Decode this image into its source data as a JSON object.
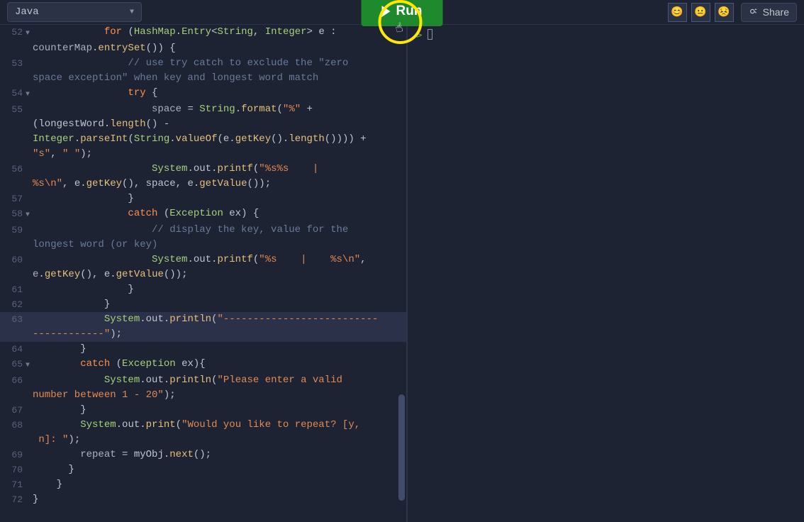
{
  "toolbar": {
    "language": "Java",
    "run_label": "Run",
    "share_label": "Share",
    "avatars": [
      "😊",
      "😐",
      "😣"
    ]
  },
  "console": {
    "prompt": ">"
  },
  "editor": {
    "lines": [
      {
        "num": "52",
        "fold": "▼",
        "indent": 12,
        "tokens": [
          {
            "c": "kw",
            "t": "for"
          },
          {
            "c": "op",
            "t": " ("
          },
          {
            "c": "type",
            "t": "HashMap"
          },
          {
            "c": "op",
            "t": "."
          },
          {
            "c": "type",
            "t": "Entry"
          },
          {
            "c": "op",
            "t": "<"
          },
          {
            "c": "type",
            "t": "String"
          },
          {
            "c": "op",
            "t": ", "
          },
          {
            "c": "type",
            "t": "Integer"
          },
          {
            "c": "op",
            "t": "> e : "
          }
        ],
        "wrap": [
          {
            "c": "id",
            "t": "counterMap"
          },
          {
            "c": "op",
            "t": "."
          },
          {
            "c": "fn",
            "t": "entrySet"
          },
          {
            "c": "op",
            "t": "()) {"
          }
        ]
      },
      {
        "num": "53",
        "indent": 16,
        "tokens": [
          {
            "c": "cmt",
            "t": "// use try catch to exclude the \"zero "
          }
        ],
        "wrap": [
          {
            "c": "cmt",
            "t": "space exception\" when key and longest word match"
          }
        ]
      },
      {
        "num": "54",
        "fold": "▼",
        "indent": 16,
        "tokens": [
          {
            "c": "kw",
            "t": "try"
          },
          {
            "c": "op",
            "t": " {"
          }
        ]
      },
      {
        "num": "55",
        "indent": 20,
        "tokens": [
          {
            "c": "id",
            "t": "space"
          },
          {
            "c": "op",
            "t": " = "
          },
          {
            "c": "type",
            "t": "String"
          },
          {
            "c": "op",
            "t": "."
          },
          {
            "c": "fn",
            "t": "format"
          },
          {
            "c": "op",
            "t": "("
          },
          {
            "c": "str",
            "t": "\"%\""
          },
          {
            "c": "op",
            "t": " + "
          }
        ],
        "wrap": [
          {
            "c": "op",
            "t": "(longestWord."
          },
          {
            "c": "fn",
            "t": "length"
          },
          {
            "c": "op",
            "t": "() - "
          }
        ],
        "wrap2": [
          {
            "c": "type",
            "t": "Integer"
          },
          {
            "c": "op",
            "t": "."
          },
          {
            "c": "fn",
            "t": "parseInt"
          },
          {
            "c": "op",
            "t": "("
          },
          {
            "c": "type",
            "t": "String"
          },
          {
            "c": "op",
            "t": "."
          },
          {
            "c": "fn",
            "t": "valueOf"
          },
          {
            "c": "op",
            "t": "(e."
          },
          {
            "c": "fn",
            "t": "getKey"
          },
          {
            "c": "op",
            "t": "()."
          },
          {
            "c": "fn",
            "t": "length"
          },
          {
            "c": "op",
            "t": "()))) + "
          }
        ],
        "wrap3": [
          {
            "c": "str",
            "t": "\"s\""
          },
          {
            "c": "op",
            "t": ", "
          },
          {
            "c": "str",
            "t": "\" \""
          },
          {
            "c": "op",
            "t": ");"
          }
        ]
      },
      {
        "num": "56",
        "indent": 20,
        "tokens": [
          {
            "c": "type",
            "t": "System"
          },
          {
            "c": "op",
            "t": ".out."
          },
          {
            "c": "fn",
            "t": "printf"
          },
          {
            "c": "op",
            "t": "("
          },
          {
            "c": "str",
            "t": "\"%s%s    |    "
          }
        ],
        "wrap": [
          {
            "c": "str",
            "t": "%s\\n\""
          },
          {
            "c": "op",
            "t": ", e."
          },
          {
            "c": "fn",
            "t": "getKey"
          },
          {
            "c": "op",
            "t": "(), space, e."
          },
          {
            "c": "fn",
            "t": "getValue"
          },
          {
            "c": "op",
            "t": "());"
          }
        ]
      },
      {
        "num": "57",
        "indent": 16,
        "tokens": [
          {
            "c": "op",
            "t": "}"
          }
        ]
      },
      {
        "num": "58",
        "fold": "▼",
        "indent": 16,
        "tokens": [
          {
            "c": "kw",
            "t": "catch"
          },
          {
            "c": "op",
            "t": " ("
          },
          {
            "c": "type",
            "t": "Exception"
          },
          {
            "c": "op",
            "t": " ex) {"
          }
        ]
      },
      {
        "num": "59",
        "indent": 20,
        "tokens": [
          {
            "c": "cmt",
            "t": "// display the key, value for the "
          }
        ],
        "wrap": [
          {
            "c": "cmt",
            "t": "longest word (or key)"
          }
        ]
      },
      {
        "num": "60",
        "indent": 20,
        "tokens": [
          {
            "c": "type",
            "t": "System"
          },
          {
            "c": "op",
            "t": ".out."
          },
          {
            "c": "fn",
            "t": "printf"
          },
          {
            "c": "op",
            "t": "("
          },
          {
            "c": "str",
            "t": "\"%s    |    %s\\n\""
          },
          {
            "c": "op",
            "t": ", "
          }
        ],
        "wrap": [
          {
            "c": "id",
            "t": "e"
          },
          {
            "c": "op",
            "t": "."
          },
          {
            "c": "fn",
            "t": "getKey"
          },
          {
            "c": "op",
            "t": "(), e."
          },
          {
            "c": "fn",
            "t": "getValue"
          },
          {
            "c": "op",
            "t": "());"
          }
        ]
      },
      {
        "num": "61",
        "indent": 16,
        "tokens": [
          {
            "c": "op",
            "t": "}"
          }
        ]
      },
      {
        "num": "62",
        "indent": 12,
        "tokens": [
          {
            "c": "op",
            "t": "}"
          }
        ]
      },
      {
        "num": "63",
        "indent": 12,
        "current": true,
        "tokens": [
          {
            "c": "type",
            "t": "System"
          },
          {
            "c": "op",
            "t": ".out."
          },
          {
            "c": "fn",
            "t": "println"
          },
          {
            "c": "op",
            "t": "("
          },
          {
            "c": "str",
            "t": "\"--------------------------"
          }
        ],
        "wrap": [
          {
            "c": "str",
            "t": "------------\""
          },
          {
            "c": "op",
            "t": ");"
          }
        ]
      },
      {
        "num": "64",
        "indent": 8,
        "tokens": [
          {
            "c": "op",
            "t": "}"
          }
        ]
      },
      {
        "num": "65",
        "fold": "▼",
        "indent": 8,
        "tokens": [
          {
            "c": "kw",
            "t": "catch"
          },
          {
            "c": "op",
            "t": " ("
          },
          {
            "c": "type",
            "t": "Exception"
          },
          {
            "c": "op",
            "t": " ex){"
          }
        ]
      },
      {
        "num": "66",
        "indent": 12,
        "tokens": [
          {
            "c": "type",
            "t": "System"
          },
          {
            "c": "op",
            "t": ".out."
          },
          {
            "c": "fn",
            "t": "println"
          },
          {
            "c": "op",
            "t": "("
          },
          {
            "c": "str",
            "t": "\"Please enter a valid "
          }
        ],
        "wrap": [
          {
            "c": "str",
            "t": "number between 1 - 20\""
          },
          {
            "c": "op",
            "t": ");"
          }
        ]
      },
      {
        "num": "67",
        "indent": 8,
        "tokens": [
          {
            "c": "op",
            "t": "}"
          }
        ]
      },
      {
        "num": "68",
        "indent": 8,
        "tokens": [
          {
            "c": "type",
            "t": "System"
          },
          {
            "c": "op",
            "t": ".out."
          },
          {
            "c": "fn",
            "t": "print"
          },
          {
            "c": "op",
            "t": "("
          },
          {
            "c": "str",
            "t": "\"Would you like to repeat? [y,"
          }
        ],
        "wrap": [
          {
            "c": "str",
            "t": " n]: \""
          },
          {
            "c": "op",
            "t": ");"
          }
        ]
      },
      {
        "num": "69",
        "indent": 8,
        "tokens": [
          {
            "c": "id",
            "t": "repeat"
          },
          {
            "c": "op",
            "t": " = myObj."
          },
          {
            "c": "fn",
            "t": "next"
          },
          {
            "c": "op",
            "t": "();"
          }
        ]
      },
      {
        "num": "70",
        "indent": 6,
        "tokens": [
          {
            "c": "op",
            "t": "}"
          }
        ]
      },
      {
        "num": "71",
        "indent": 4,
        "tokens": [
          {
            "c": "op",
            "t": "}"
          }
        ]
      },
      {
        "num": "72",
        "indent": 0,
        "tokens": [
          {
            "c": "op",
            "t": "}"
          }
        ]
      }
    ]
  }
}
